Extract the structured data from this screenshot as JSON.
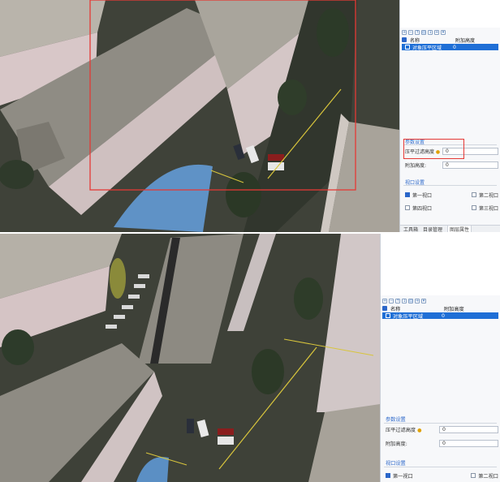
{
  "colors": {
    "highlight": "#e53935",
    "selection": "#1f6fd6",
    "accent": "#2a66c9"
  },
  "top": {
    "toolbar_icons": [
      "add-icon",
      "remove-icon",
      "up-icon",
      "down-icon",
      "edit-icon",
      "import-icon",
      "export-icon"
    ],
    "columns": [
      "名称",
      "附加高度"
    ],
    "row": {
      "name": "对象压平区域",
      "value": "0"
    },
    "params_title": "参数设置",
    "flatten_label": "压平过滤高度",
    "flatten_value": "0",
    "extra_label": "附加高度:",
    "extra_value": "0",
    "window_title": "视口设置",
    "window_options": [
      "第一视口",
      "第二视口",
      "第四视口",
      "第三视口"
    ],
    "tabs": [
      "工具箱",
      "目录管理",
      "图层属性"
    ]
  },
  "bottom": {
    "toolbar_icons": [
      "add-icon",
      "remove-icon",
      "up-icon",
      "down-icon",
      "edit-icon",
      "import-icon",
      "export-icon"
    ],
    "columns": [
      "名称",
      "附加高度"
    ],
    "row": {
      "name": "对象压平区域",
      "value": "0"
    },
    "params_title": "参数设置",
    "flatten_label": "压平过滤高度",
    "flatten_value": "0",
    "extra_label": "附加高度:",
    "extra_value": "0",
    "window_title": "视口设置",
    "window_options": [
      "第一视口",
      "第二视口"
    ]
  }
}
